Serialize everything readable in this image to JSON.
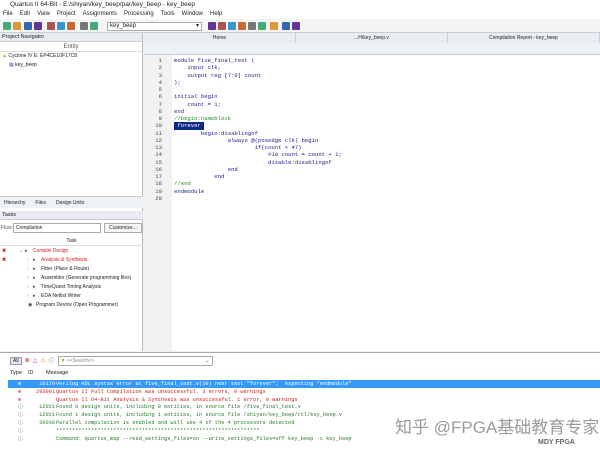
{
  "title": "Quartus II 64-Bit - E:/shiyan/key_beep/par/key_beep - key_beep",
  "menu": [
    "File",
    "Edit",
    "View",
    "Project",
    "Assignments",
    "Processing",
    "Tools",
    "Window",
    "Help"
  ],
  "toolbar": {
    "project_combo": "key_beep"
  },
  "navigator": {
    "title": "Project Navigator",
    "col": "Entity",
    "device": "Cyclone IV E: EP4CE10F17C8",
    "top": "key_beep",
    "tabs": [
      "Hierarchy",
      "Files",
      "Design Units"
    ]
  },
  "tasks": {
    "title": "Tasks",
    "flow_label": "Flow:",
    "flow": "Compilation",
    "customize": "Customize...",
    "col": "Task",
    "items": [
      {
        "label": "Compile Design",
        "status": "error"
      },
      {
        "label": "Analysis & Synthesis",
        "status": "error"
      },
      {
        "label": "Fitter (Place & Route)",
        "status": ""
      },
      {
        "label": "Assembler (Generate programming files)",
        "status": ""
      },
      {
        "label": "TimeQuest Timing Analysis",
        "status": ""
      },
      {
        "label": "EDA Netlist Writer",
        "status": ""
      },
      {
        "label": "Program Device (Open Programmer)",
        "status": ""
      }
    ]
  },
  "editor": {
    "tabs": [
      "Home",
      "...H/key_beep.v",
      "Compilation Report - key_beep"
    ],
    "lines": [
      "module five_final_test (",
      "    input clk,",
      "    output reg [7:0] count",
      ");",
      "",
      "initial begin",
      "    count = 1;",
      "end",
      "//begin:nameblock",
      " forever ",
      "        begin:disablingof",
      "                always @(posedge clk) begin",
      "                        if(count < 47)",
      "                            #10 count = count + 1;",
      "                            disable:disablingof",
      "                end",
      "            end",
      "//end",
      "endmodule",
      ""
    ],
    "selected_line": 10
  },
  "messages": {
    "search_placeholder": "<<Search>>",
    "all": "All",
    "cols": [
      "Type",
      "ID",
      "Message"
    ],
    "rows": [
      {
        "id": "10170",
        "text": "Verilog HDL syntax error at five_final_test.v(10) near text \"forever\";  expecting \"endmodule\"",
        "kind": "error",
        "selected": true
      },
      {
        "id": "293001",
        "text": "Quartus II Full Compilation was unsuccessful. 3 errors, 0 warnings",
        "kind": "error"
      },
      {
        "id": "",
        "text": "Quartus II 64-Bit Analysis & Synthesis was unsuccessful. 1 error, 0 warnings",
        "kind": "error"
      },
      {
        "id": "12021",
        "text": "Found 0 design units, including 0 entities, in source file /five_final_test.v",
        "kind": "info"
      },
      {
        "id": "12021",
        "text": "Found 1 design units, including 1 entities, in source file /shiyan/key_beep/rtl/key_beep.v",
        "kind": "info"
      },
      {
        "id": "20030",
        "text": "Parallel compilation is enabled and will use 4 of the 4 processors detected",
        "kind": "info"
      },
      {
        "id": "",
        "text": "****************************************************************",
        "kind": "info"
      },
      {
        "id": "",
        "text": "Command: quartus_map --read_settings_files=on --write_settings_files=off key_beep -c key_beep",
        "kind": "info"
      }
    ]
  },
  "watermark": {
    "text": "知乎 @FPGA基础教育专家",
    "logo": "MDY FPGA"
  }
}
